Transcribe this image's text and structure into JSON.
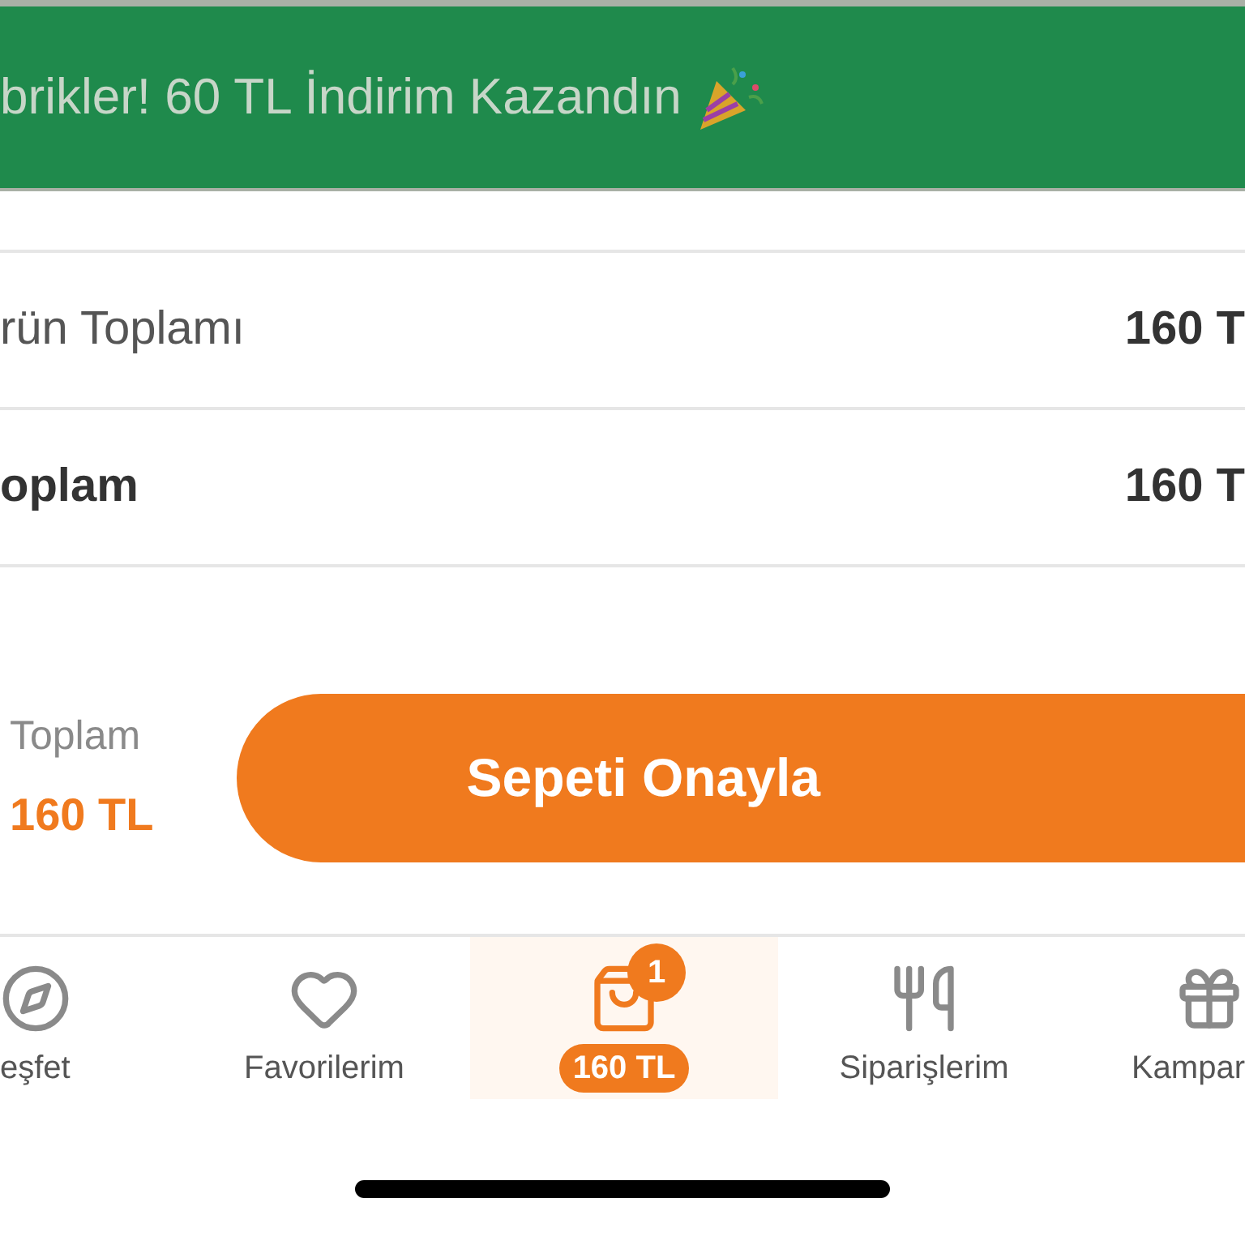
{
  "banner": {
    "text": "brikler! 60 TL İndirim Kazandın"
  },
  "summary_rows": [
    {
      "label": "rün Toplamı",
      "value": "160 T",
      "bold": false
    },
    {
      "label": "oplam",
      "value": "160 T",
      "bold": true
    }
  ],
  "checkout": {
    "total_label": "Toplam",
    "total_value": "160 TL",
    "button": "Sepeti Onayla"
  },
  "tab_bar": [
    {
      "kind": "compass",
      "label": "eşfet",
      "selected": false
    },
    {
      "kind": "heart",
      "label": "Favorilerim",
      "selected": false
    },
    {
      "kind": "cart",
      "label": "160 TL",
      "badge": "1",
      "selected": true
    },
    {
      "kind": "utensils",
      "label": "Siparişlerim",
      "selected": false
    },
    {
      "kind": "gift",
      "label": "Kampar",
      "selected": false
    }
  ]
}
